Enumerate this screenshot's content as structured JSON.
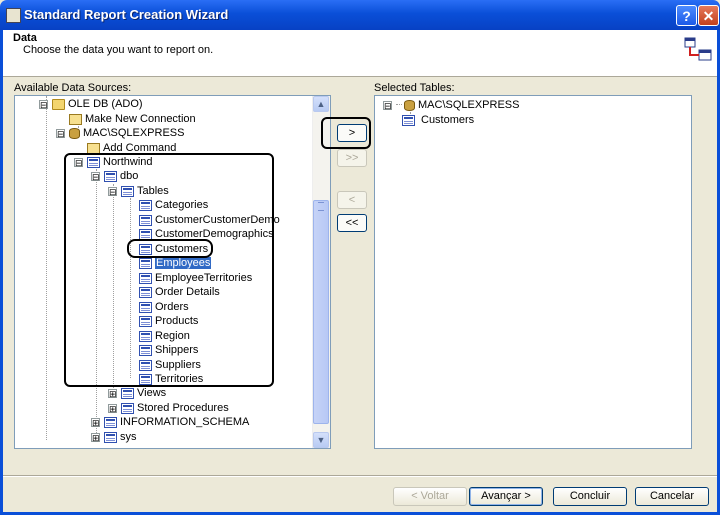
{
  "window": {
    "title": "Standard Report Creation Wizard",
    "help_glyph": "?",
    "close_glyph": "✕"
  },
  "header": {
    "title": "Data",
    "subtitle": "Choose the data you want to report on."
  },
  "available": {
    "label": "Available Data Sources:",
    "nodes": [
      {
        "text": "OLE DB (ADO)",
        "icon": "folder-icon",
        "expander": "⊟"
      },
      {
        "text": "Make New Connection",
        "icon": "new-connection-icon",
        "expander": ""
      },
      {
        "text": "MAC\\SQLEXPRESS",
        "icon": "server-icon",
        "expander": "⊟"
      },
      {
        "text": "Add Command",
        "icon": "add-command-icon",
        "expander": ""
      },
      {
        "text": "Northwind",
        "icon": "database-icon",
        "expander": "⊟"
      },
      {
        "text": "dbo",
        "icon": "schema-icon",
        "expander": "⊟"
      },
      {
        "text": "Tables",
        "icon": "tables-icon",
        "expander": "⊟"
      },
      {
        "text": "Categories",
        "icon": "table-icon",
        "expander": ""
      },
      {
        "text": "CustomerCustomerDemo",
        "icon": "table-icon",
        "expander": ""
      },
      {
        "text": "CustomerDemographics",
        "icon": "table-icon",
        "expander": ""
      },
      {
        "text": "Customers",
        "icon": "table-icon",
        "expander": ""
      },
      {
        "text": "Employees",
        "icon": "table-icon",
        "expander": "",
        "selected": true
      },
      {
        "text": "EmployeeTerritories",
        "icon": "table-icon",
        "expander": ""
      },
      {
        "text": "Order Details",
        "icon": "table-icon",
        "expander": ""
      },
      {
        "text": "Orders",
        "icon": "table-icon",
        "expander": ""
      },
      {
        "text": "Products",
        "icon": "table-icon",
        "expander": ""
      },
      {
        "text": "Region",
        "icon": "table-icon",
        "expander": ""
      },
      {
        "text": "Shippers",
        "icon": "table-icon",
        "expander": ""
      },
      {
        "text": "Suppliers",
        "icon": "table-icon",
        "expander": ""
      },
      {
        "text": "Territories",
        "icon": "table-icon",
        "expander": ""
      },
      {
        "text": "Views",
        "icon": "views-icon",
        "expander": "⊞"
      },
      {
        "text": "Stored Procedures",
        "icon": "procedures-icon",
        "expander": "⊞"
      },
      {
        "text": "INFORMATION_SCHEMA",
        "icon": "schema-icon",
        "expander": "⊞"
      },
      {
        "text": "sys",
        "icon": "schema-icon",
        "expander": "⊞"
      }
    ]
  },
  "transfer_buttons": {
    "add": ">",
    "add_all": ">>",
    "remove": "<",
    "remove_all": "<<"
  },
  "selected": {
    "label": "Selected Tables:",
    "nodes": [
      {
        "text": "MAC\\SQLEXPRESS",
        "icon": "server-icon",
        "expander": "⊟"
      },
      {
        "text": "Customers",
        "icon": "table-icon",
        "expander": ""
      }
    ]
  },
  "footer": {
    "back": "< Voltar",
    "next": "Avançar >",
    "finish": "Concluir",
    "cancel": "Cancelar"
  },
  "colors": {
    "titlebar": "#0a4fd8",
    "selection": "#316ac5",
    "dialog_bg": "#ece9d8"
  }
}
